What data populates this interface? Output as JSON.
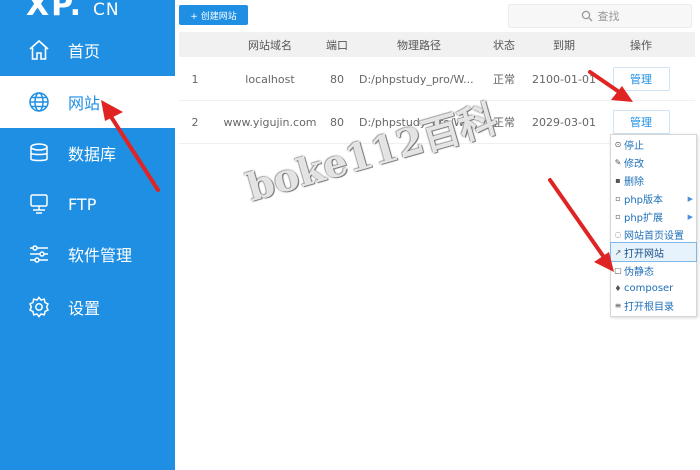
{
  "brand": {
    "logo": "XP.",
    "suffix": "CN"
  },
  "sidebar": {
    "items": [
      {
        "label": "首页",
        "icon": "home-icon",
        "active": false
      },
      {
        "label": "网站",
        "icon": "globe-icon",
        "active": true
      },
      {
        "label": "数据库",
        "icon": "database-icon",
        "active": false
      },
      {
        "label": "FTP",
        "icon": "ftp-icon",
        "active": false
      },
      {
        "label": "软件管理",
        "icon": "sliders-icon",
        "active": false
      },
      {
        "label": "设置",
        "icon": "gear-icon",
        "active": false
      }
    ]
  },
  "toolbar": {
    "create_label": "+ 创建网站",
    "search_placeholder": "查找"
  },
  "table": {
    "headers": [
      "网站域名",
      "端口",
      "物理路径",
      "状态",
      "到期",
      "操作"
    ],
    "rows": [
      {
        "num": "1",
        "domain": "localhost",
        "port": "80",
        "path": "D:/phpstudy_pro/W...",
        "status": "正常",
        "expiry": "2100-01-01",
        "action": "管理"
      },
      {
        "num": "2",
        "domain": "www.yigujin.com",
        "port": "80",
        "path": "D:/phpstudy_pro/W...",
        "status": "正常",
        "expiry": "2029-03-01",
        "action": "管理"
      }
    ]
  },
  "context_menu": {
    "items": [
      {
        "label": "停止",
        "icon": "stop-icon",
        "submenu": false
      },
      {
        "label": "修改",
        "icon": "edit-icon",
        "submenu": false
      },
      {
        "label": "删除",
        "icon": "trash-icon",
        "submenu": false
      },
      {
        "label": "php版本",
        "icon": "php-version-icon",
        "submenu": true
      },
      {
        "label": "php扩展",
        "icon": "php-ext-icon",
        "submenu": true
      },
      {
        "label": "网站首页设置",
        "icon": "home-setting-icon",
        "submenu": false
      },
      {
        "label": "打开网站",
        "icon": "open-site-icon",
        "submenu": false,
        "highlighted": true
      },
      {
        "label": "伪静态",
        "icon": "rewrite-icon",
        "submenu": false
      },
      {
        "label": "composer",
        "icon": "composer-icon",
        "submenu": false
      },
      {
        "label": "打开根目录",
        "icon": "folder-icon",
        "submenu": false
      }
    ]
  },
  "watermark": {
    "text": "boke112百科"
  },
  "colors": {
    "accent": "#1e8fe3",
    "annotation": "#e02424"
  }
}
